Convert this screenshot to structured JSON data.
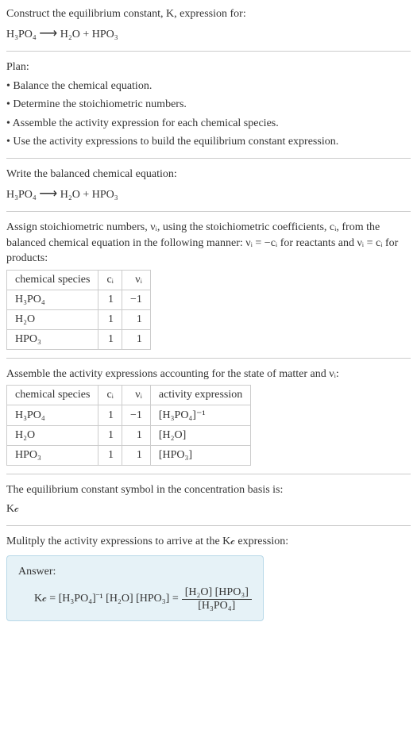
{
  "header": {
    "prompt": "Construct the equilibrium constant, K, expression for:",
    "equation_lhs": "H₃PO₄",
    "arrow": "⟶",
    "equation_rhs": "H₂O + HPO₃"
  },
  "plan": {
    "title": "Plan:",
    "items": [
      "• Balance the chemical equation.",
      "• Determine the stoichiometric numbers.",
      "• Assemble the activity expression for each chemical species.",
      "• Use the activity expressions to build the equilibrium constant expression."
    ]
  },
  "balanced": {
    "title": "Write the balanced chemical equation:",
    "equation_lhs": "H₃PO₄",
    "arrow": "⟶",
    "equation_rhs": "H₂O + HPO₃"
  },
  "assign": {
    "text_part1": "Assign stoichiometric numbers, νᵢ, using the stoichiometric coefficients, cᵢ, from the balanced chemical equation in the following manner: νᵢ = −cᵢ for reactants and νᵢ = cᵢ for products:",
    "headers": [
      "chemical species",
      "cᵢ",
      "νᵢ"
    ],
    "rows": [
      {
        "species": "H₃PO₄",
        "c": "1",
        "nu": "−1"
      },
      {
        "species": "H₂O",
        "c": "1",
        "nu": "1"
      },
      {
        "species": "HPO₃",
        "c": "1",
        "nu": "1"
      }
    ]
  },
  "activity": {
    "title": "Assemble the activity expressions accounting for the state of matter and νᵢ:",
    "headers": [
      "chemical species",
      "cᵢ",
      "νᵢ",
      "activity expression"
    ],
    "rows": [
      {
        "species": "H₃PO₄",
        "c": "1",
        "nu": "−1",
        "expr": "[H₃PO₄]⁻¹"
      },
      {
        "species": "H₂O",
        "c": "1",
        "nu": "1",
        "expr": "[H₂O]"
      },
      {
        "species": "HPO₃",
        "c": "1",
        "nu": "1",
        "expr": "[HPO₃]"
      }
    ]
  },
  "symbol": {
    "text": "The equilibrium constant symbol in the concentration basis is:",
    "value": "K𝒸"
  },
  "multiply": {
    "text": "Mulitply the activity expressions to arrive at the K𝒸 expression:"
  },
  "answer": {
    "label": "Answer:",
    "lhs": "K𝒸 = [H₃PO₄]⁻¹ [H₂O] [HPO₃] = ",
    "frac_num": "[H₂O] [HPO₃]",
    "frac_den": "[H₃PO₄]"
  }
}
